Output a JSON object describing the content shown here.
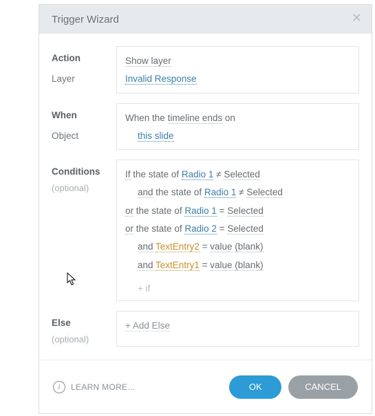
{
  "title": "Trigger Wizard",
  "sections": {
    "action": {
      "label": "Action",
      "sub": "Layer",
      "value": "Show layer",
      "layer": "Invalid Response"
    },
    "when": {
      "label": "When",
      "sub": "Object",
      "prefix": "When the",
      "event": "timeline ends",
      "suffix": "on",
      "object": "this slide"
    },
    "conditions": {
      "label": "Conditions",
      "optional": "(optional)",
      "lines": [
        {
          "indent": 0,
          "pre": "If",
          "mid": "the state of",
          "obj": "Radio 1",
          "op": "≠",
          "val": "Selected"
        },
        {
          "indent": 1,
          "pre": "and",
          "mid": "the state of",
          "obj": "Radio 1",
          "op": "≠",
          "val": "Selected"
        },
        {
          "indent": 0,
          "pre": "or",
          "mid": "the state of",
          "obj": "Radio 1",
          "op": "=",
          "val": "Selected"
        },
        {
          "indent": 0,
          "pre": "or",
          "mid": "the state of",
          "obj": "Radio 2",
          "op": "=",
          "val": "Selected"
        },
        {
          "indent": 1,
          "pre": "and",
          "obj2": "TextEntry2",
          "op": "=",
          "mid2": "value",
          "val2": "(blank)"
        },
        {
          "indent": 1,
          "pre": "and",
          "obj2": "TextEntry1",
          "op": "=",
          "mid2": "value",
          "val2": "(blank)"
        }
      ],
      "addIf": "+ if"
    },
    "else": {
      "label": "Else",
      "optional": "(optional)",
      "add": "+ Add Else"
    }
  },
  "footer": {
    "learn": "LEARN MORE...",
    "ok": "OK",
    "cancel": "CANCEL"
  }
}
